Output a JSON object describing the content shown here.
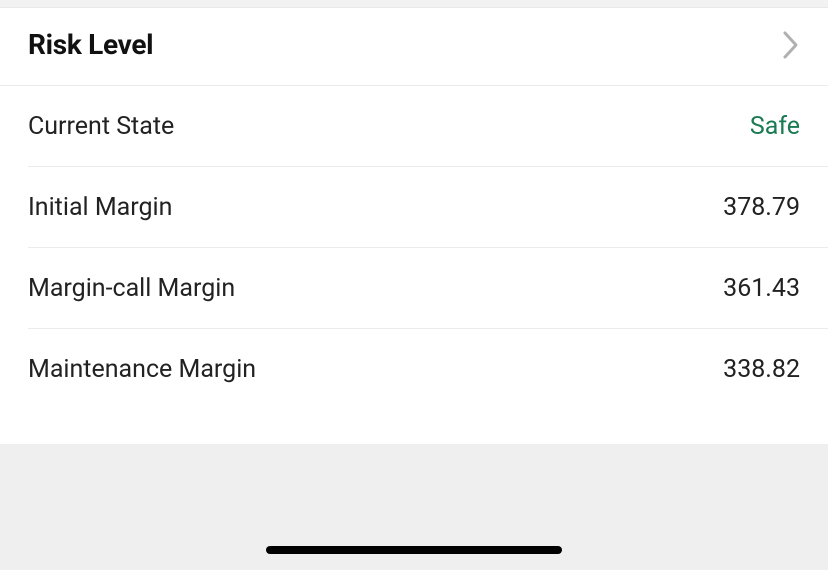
{
  "header": {
    "title": "Risk Level"
  },
  "rows": {
    "currentState": {
      "label": "Current State",
      "value": "Safe"
    },
    "initialMargin": {
      "label": "Initial Margin",
      "value": "378.79"
    },
    "marginCallMargin": {
      "label": "Margin-call Margin",
      "value": "361.43"
    },
    "maintenanceMargin": {
      "label": "Maintenance Margin",
      "value": "338.82"
    }
  },
  "colors": {
    "safe": "#1a7a52"
  }
}
